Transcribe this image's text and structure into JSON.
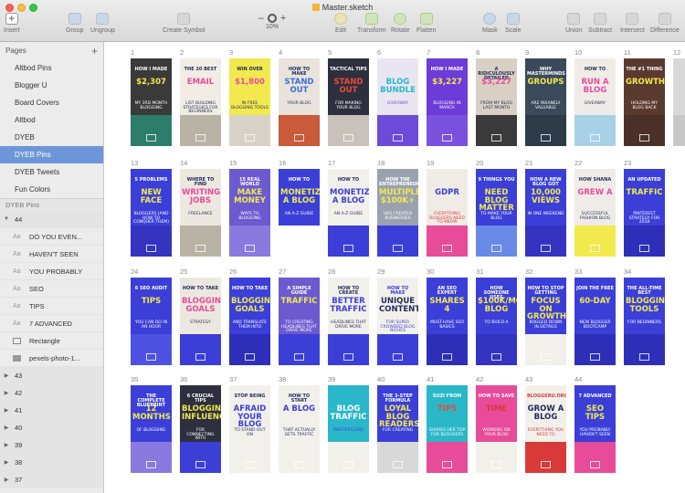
{
  "app": {
    "document_title": "Master.sketch"
  },
  "toolbar": {
    "insert": "Insert",
    "group": "Group",
    "ungroup": "Ungroup",
    "create_symbol": "Create Symbol",
    "zoom_level": "10%",
    "edit": "Edit",
    "transform": "Transform",
    "rotate": "Rotate",
    "flatten": "Flatten",
    "mask": "Mask",
    "scale": "Scale",
    "union": "Union",
    "subtract": "Subtract",
    "intersect": "Intersect",
    "difference": "Difference"
  },
  "sidebar": {
    "pages_label": "Pages",
    "pages": [
      "Altbod Pins",
      "Blogger U",
      "Board Covers",
      "Altbod",
      "DYEB",
      "DYEB Pins",
      "DYEB Tweets",
      "Fun Colors"
    ],
    "selected_page": "DYEB Pins",
    "layers_label": "DYEB Pins",
    "open_group": "44",
    "group_children": [
      {
        "type": "text",
        "name": "DO YOU EVEN..."
      },
      {
        "type": "text",
        "name": "HAVEN'T SEEN"
      },
      {
        "type": "text",
        "name": "YOU PROBABLY"
      },
      {
        "type": "text",
        "name": "SEO"
      },
      {
        "type": "text",
        "name": "TIPS"
      },
      {
        "type": "text",
        "name": "7 ADVANCED"
      },
      {
        "type": "shape",
        "name": "Rectangle"
      },
      {
        "type": "image",
        "name": "pexels-photo-1..."
      }
    ],
    "collapsed_groups": [
      "43",
      "42",
      "41",
      "40",
      "39",
      "38",
      "37"
    ]
  },
  "artboards": [
    {
      "n": "1",
      "bg": "#3a3a3a",
      "band": "#2d7d6a",
      "fg": "#ffffff",
      "accent": "#f2e94e",
      "l1": "How I made",
      "l2": "$2,307",
      "l3": "my 3rd month blogging"
    },
    {
      "n": "2",
      "bg": "#f1ede4",
      "band": "#b9b3a5",
      "fg": "#1e2a5a",
      "accent": "#e84b9a",
      "l1": "The 20 best",
      "l2": "EMAIL",
      "l3": "list building strategies for beginners"
    },
    {
      "n": "3",
      "bg": "#f2e94e",
      "band": "#d9d2c8",
      "fg": "#1e2a5a",
      "accent": "#e84b9a",
      "l1": "Win over",
      "l2": "$1,800",
      "l3": "in free blogging tools"
    },
    {
      "n": "4",
      "bg": "#e9e3dc",
      "band": "#c95a3a",
      "fg": "#1e2a5a",
      "accent": "#3b6fd8",
      "l1": "How to make",
      "l2": "STAND OUT",
      "l3": "your blog"
    },
    {
      "n": "5",
      "bg": "#2d2f3e",
      "band": "#c8c2ba",
      "fg": "#ffffff",
      "accent": "#e84b3a",
      "l1": "Tactical tips",
      "l2": "STAND OUT",
      "l3": "for making your blog"
    },
    {
      "n": "6",
      "bg": "#e9e6f1",
      "band": "#6c4bd8",
      "fg": "#6c4bd8",
      "accent": "#2ab7c9",
      "l1": "",
      "l2": "BLOG BUNDLE",
      "l3": "giveaway"
    },
    {
      "n": "7",
      "bg": "#6c3bd8",
      "band": "#7b51e0",
      "fg": "#ffffff",
      "accent": "#f2e94e",
      "l1": "How I made",
      "l2": "$3,227",
      "l3": "blogging in March"
    },
    {
      "n": "8",
      "bg": "#d9d0c4",
      "band": "#3a3a3a",
      "fg": "#1e2a5a",
      "accent": "#e84b9a",
      "l1": "A ridiculously detailed",
      "l2": "$3,227",
      "l3": "from my blog last month"
    },
    {
      "n": "9",
      "bg": "#3a4a5a",
      "band": "#2d3a48",
      "fg": "#ffffff",
      "accent": "#f2e94e",
      "l1": "Why masterminds",
      "l2": "GROUPS",
      "l3": "are insanely valuable"
    },
    {
      "n": "10",
      "bg": "#efece7",
      "band": "#a8d0e6",
      "fg": "#1e2a5a",
      "accent": "#e84b9a",
      "l1": "How to",
      "l2": "RUN A BLOG",
      "l3": "giveaway"
    },
    {
      "n": "11",
      "bg": "#5a3a2f",
      "band": "#4a3028",
      "fg": "#ffffff",
      "accent": "#f2e94e",
      "l1": "The #1 thing",
      "l2": "GROWTH",
      "l3": "holding my blog back"
    },
    {
      "n": "12",
      "bg": "#d8d8d8",
      "band": "#c8c8c8",
      "fg": "#9a9a9a",
      "accent": "#9a9a9a",
      "l1": "",
      "l2": "",
      "l3": ""
    },
    {
      "n": "13",
      "bg": "#3b3fd8",
      "band": "#3434c0",
      "fg": "#ffffff",
      "accent": "#f2e94e",
      "l1": "5 problems",
      "l2": "NEW FACE",
      "l3": "bloggers (and how to conquer them)"
    },
    {
      "n": "14",
      "bg": "#ece8e0",
      "band": "#b9b3a5",
      "fg": "#1e2a5a",
      "accent": "#e84b9a",
      "l1": "Where to find",
      "l2": "WRITING JOBS",
      "l3": "freelance"
    },
    {
      "n": "15",
      "bg": "#6c5ad0",
      "band": "#8a7ae0",
      "fg": "#ffffff",
      "accent": "#f2e94e",
      "l1": "15 real world",
      "l2": "MAKE MONEY",
      "l3": "ways to blogging"
    },
    {
      "n": "16",
      "bg": "#3b3fd8",
      "band": "#ffffff",
      "fg": "#ffffff",
      "accent": "#f2e94e",
      "l1": "How to",
      "l2": "MONETIZE A BLOG",
      "l3": "an A-Z guide"
    },
    {
      "n": "17",
      "bg": "#f2f0ea",
      "band": "#3b3fd8",
      "fg": "#1e2a5a",
      "accent": "#3b3fd8",
      "l1": "How to",
      "l2": "MONETIZE A BLOG",
      "l3": "an A-Z guide"
    },
    {
      "n": "18",
      "bg": "#9aa2b0",
      "band": "#3b3fd8",
      "fg": "#ffffff",
      "accent": "#f2e94e",
      "l1": "How the entrepreneur",
      "l2": "MULTIPLE $100K+",
      "l3": "has created businesses"
    },
    {
      "n": "19",
      "bg": "#f0ebe4",
      "band": "#e84b9a",
      "fg": "#d83a3a",
      "accent": "#3b3fd8",
      "l1": "",
      "l2": "GDPR",
      "l3": "everything bloggers need to know"
    },
    {
      "n": "20",
      "bg": "#3b3fd8",
      "band": "#6a8ae8",
      "fg": "#ffffff",
      "accent": "#f2e94e",
      "l1": "9 things you",
      "l2": "NEED BLOG MATTER",
      "l3": "to make your blog"
    },
    {
      "n": "21",
      "bg": "#3b3fd8",
      "band": "#3434c0",
      "fg": "#ffffff",
      "accent": "#f2e94e",
      "l1": "How a new blog got",
      "l2": "10,000 VIEWS",
      "l3": "in one weekend"
    },
    {
      "n": "22",
      "bg": "#efece7",
      "band": "#f2e94e",
      "fg": "#1e2a5a",
      "accent": "#e84b9a",
      "l1": "How Shana",
      "l2": "GREW A",
      "l3": "successful fashion blog"
    },
    {
      "n": "23",
      "bg": "#3b3fd8",
      "band": "#2d2fb8",
      "fg": "#ffffff",
      "accent": "#f2e94e",
      "l1": "An updated",
      "l2": "TRAFFIC",
      "l3": "pinterest strategy for 2018"
    },
    {
      "n": "24",
      "bg": "#3b3fd8",
      "band": "#4e52e0",
      "fg": "#ffffff",
      "accent": "#f2e94e",
      "l1": "6 SEO audit",
      "l2": "TIPS",
      "l3": "you can do in an hour"
    },
    {
      "n": "25",
      "bg": "#ece8e0",
      "band": "#3b3fd8",
      "fg": "#1e2a5a",
      "accent": "#e84b9a",
      "l1": "How to take",
      "l2": "BLOGGING GOALS",
      "l3": "strategy"
    },
    {
      "n": "26",
      "bg": "#3b3fd8",
      "band": "#2d2fb8",
      "fg": "#ffffff",
      "accent": "#f2e94e",
      "l1": "How to take",
      "l2": "BLOGGING GOALS",
      "l3": "and translate them into"
    },
    {
      "n": "27",
      "bg": "#6c5ad0",
      "band": "#3b3fd8",
      "fg": "#ffffff",
      "accent": "#f2e94e",
      "l1": "A simple guide",
      "l2": "TRAFFIC",
      "l3": "to creating headlines that drive more"
    },
    {
      "n": "28",
      "bg": "#f2f0ea",
      "band": "#3b3fd8",
      "fg": "#1e2a5a",
      "accent": "#3b3fd8",
      "l1": "How to create",
      "l2": "BETTER TRAFFIC",
      "l3": "headlines that drive more"
    },
    {
      "n": "29",
      "bg": "#f2f0ea",
      "band": "#3b3fd8",
      "fg": "#3b3fd8",
      "accent": "#1e2a5a",
      "l1": "How to make",
      "l2": "UNIQUE CONTENT",
      "l3": "for super crowded blog niches"
    },
    {
      "n": "30",
      "bg": "#3b3fd8",
      "band": "#2d2fb8",
      "fg": "#ffffff",
      "accent": "#f2e94e",
      "l1": "An SEO expert",
      "l2": "SHARES 4",
      "l3": "must-have SEO basics"
    },
    {
      "n": "31",
      "bg": "#3b3fd8",
      "band": "#3434c0",
      "fg": "#ffffff",
      "accent": "#f2e94e",
      "l1": "How someone uses",
      "l2": "$100K/MONTH BLOG",
      "l3": "to build a"
    },
    {
      "n": "32",
      "bg": "#3b3fd8",
      "band": "#f2f0ea",
      "fg": "#ffffff",
      "accent": "#f2e94e",
      "l1": "How to stop getting",
      "l2": "FOCUS ON GROWTH",
      "l3": "bogged down in details"
    },
    {
      "n": "33",
      "bg": "#3b3fd8",
      "band": "#2d2fb8",
      "fg": "#ffffff",
      "accent": "#f2e94e",
      "l1": "Join the free",
      "l2": "60-DAY",
      "l3": "new blogger bootcamp"
    },
    {
      "n": "34",
      "bg": "#3b3fd8",
      "band": "#2d2fb8",
      "fg": "#ffffff",
      "accent": "#f2e94e",
      "l1": "The all-time best",
      "l2": "BLOGGING TOOLS",
      "l3": "for beginners"
    },
    {
      "n": "35",
      "bg": "#3b3fd8",
      "band": "#8a7ae0",
      "fg": "#ffffff",
      "accent": "#f2e94e",
      "l1": "The complete blueprint",
      "l2": "12 MONTHS",
      "l3": "of blogging"
    },
    {
      "n": "36",
      "bg": "#2d2f3e",
      "band": "#3b3fd8",
      "fg": "#ffffff",
      "accent": "#f2e94e",
      "l1": "6 crucial tips",
      "l2": "BLOGGING INFLUENCERS",
      "l3": "for connecting with"
    },
    {
      "n": "37",
      "bg": "#f2f0ea",
      "band": "#f2f0ea",
      "fg": "#1e2a5a",
      "accent": "#3b3fd8",
      "l1": "Stop being",
      "l2": "AFRAID YOUR BLOG",
      "l3": "to stand out on"
    },
    {
      "n": "38",
      "bg": "#f2f0ea",
      "band": "#f2f0ea",
      "fg": "#1e2a5a",
      "accent": "#3b3fd8",
      "l1": "How to start",
      "l2": "A BLOG",
      "l3": "that actually gets traffic"
    },
    {
      "n": "39",
      "bg": "#2ab7c9",
      "band": "#f2f0ea",
      "fg": "#3b3fd8",
      "accent": "#ffffff",
      "l1": "",
      "l2": "BLOG TRAFFIC",
      "l3": "masterclass"
    },
    {
      "n": "40",
      "bg": "#3b3fd8",
      "band": "#d8d8d8",
      "fg": "#ffffff",
      "accent": "#f2e94e",
      "l1": "The 3-step formula",
      "l2": "LOYAL BLOG READERS",
      "l3": "for creating"
    },
    {
      "n": "41",
      "bg": "#2ab7c9",
      "band": "#e84b9a",
      "fg": "#ffffff",
      "accent": "#e84b3a",
      "l1": "Suzi from",
      "l2": "TIPS",
      "l3": "shares her top for bloggers"
    },
    {
      "n": "42",
      "bg": "#e84b9a",
      "band": "#f2f0ea",
      "fg": "#ffffff",
      "accent": "#d83a3a",
      "l1": "How to save",
      "l2": "TIME",
      "l3": "working on your blog"
    },
    {
      "n": "43",
      "bg": "#f2f0ea",
      "band": "#d83a3a",
      "fg": "#d83a3a",
      "accent": "#1e2a5a",
      "l1": "BloggerU.org",
      "l2": "GROW A BLOG",
      "l3": "everything you need to"
    },
    {
      "n": "44",
      "bg": "#3b3fd8",
      "band": "#e84b9a",
      "fg": "#ffffff",
      "accent": "#f2e94e",
      "l1": "7 advanced",
      "l2": "SEO TIPS",
      "l3": "you probably haven't seen"
    }
  ]
}
